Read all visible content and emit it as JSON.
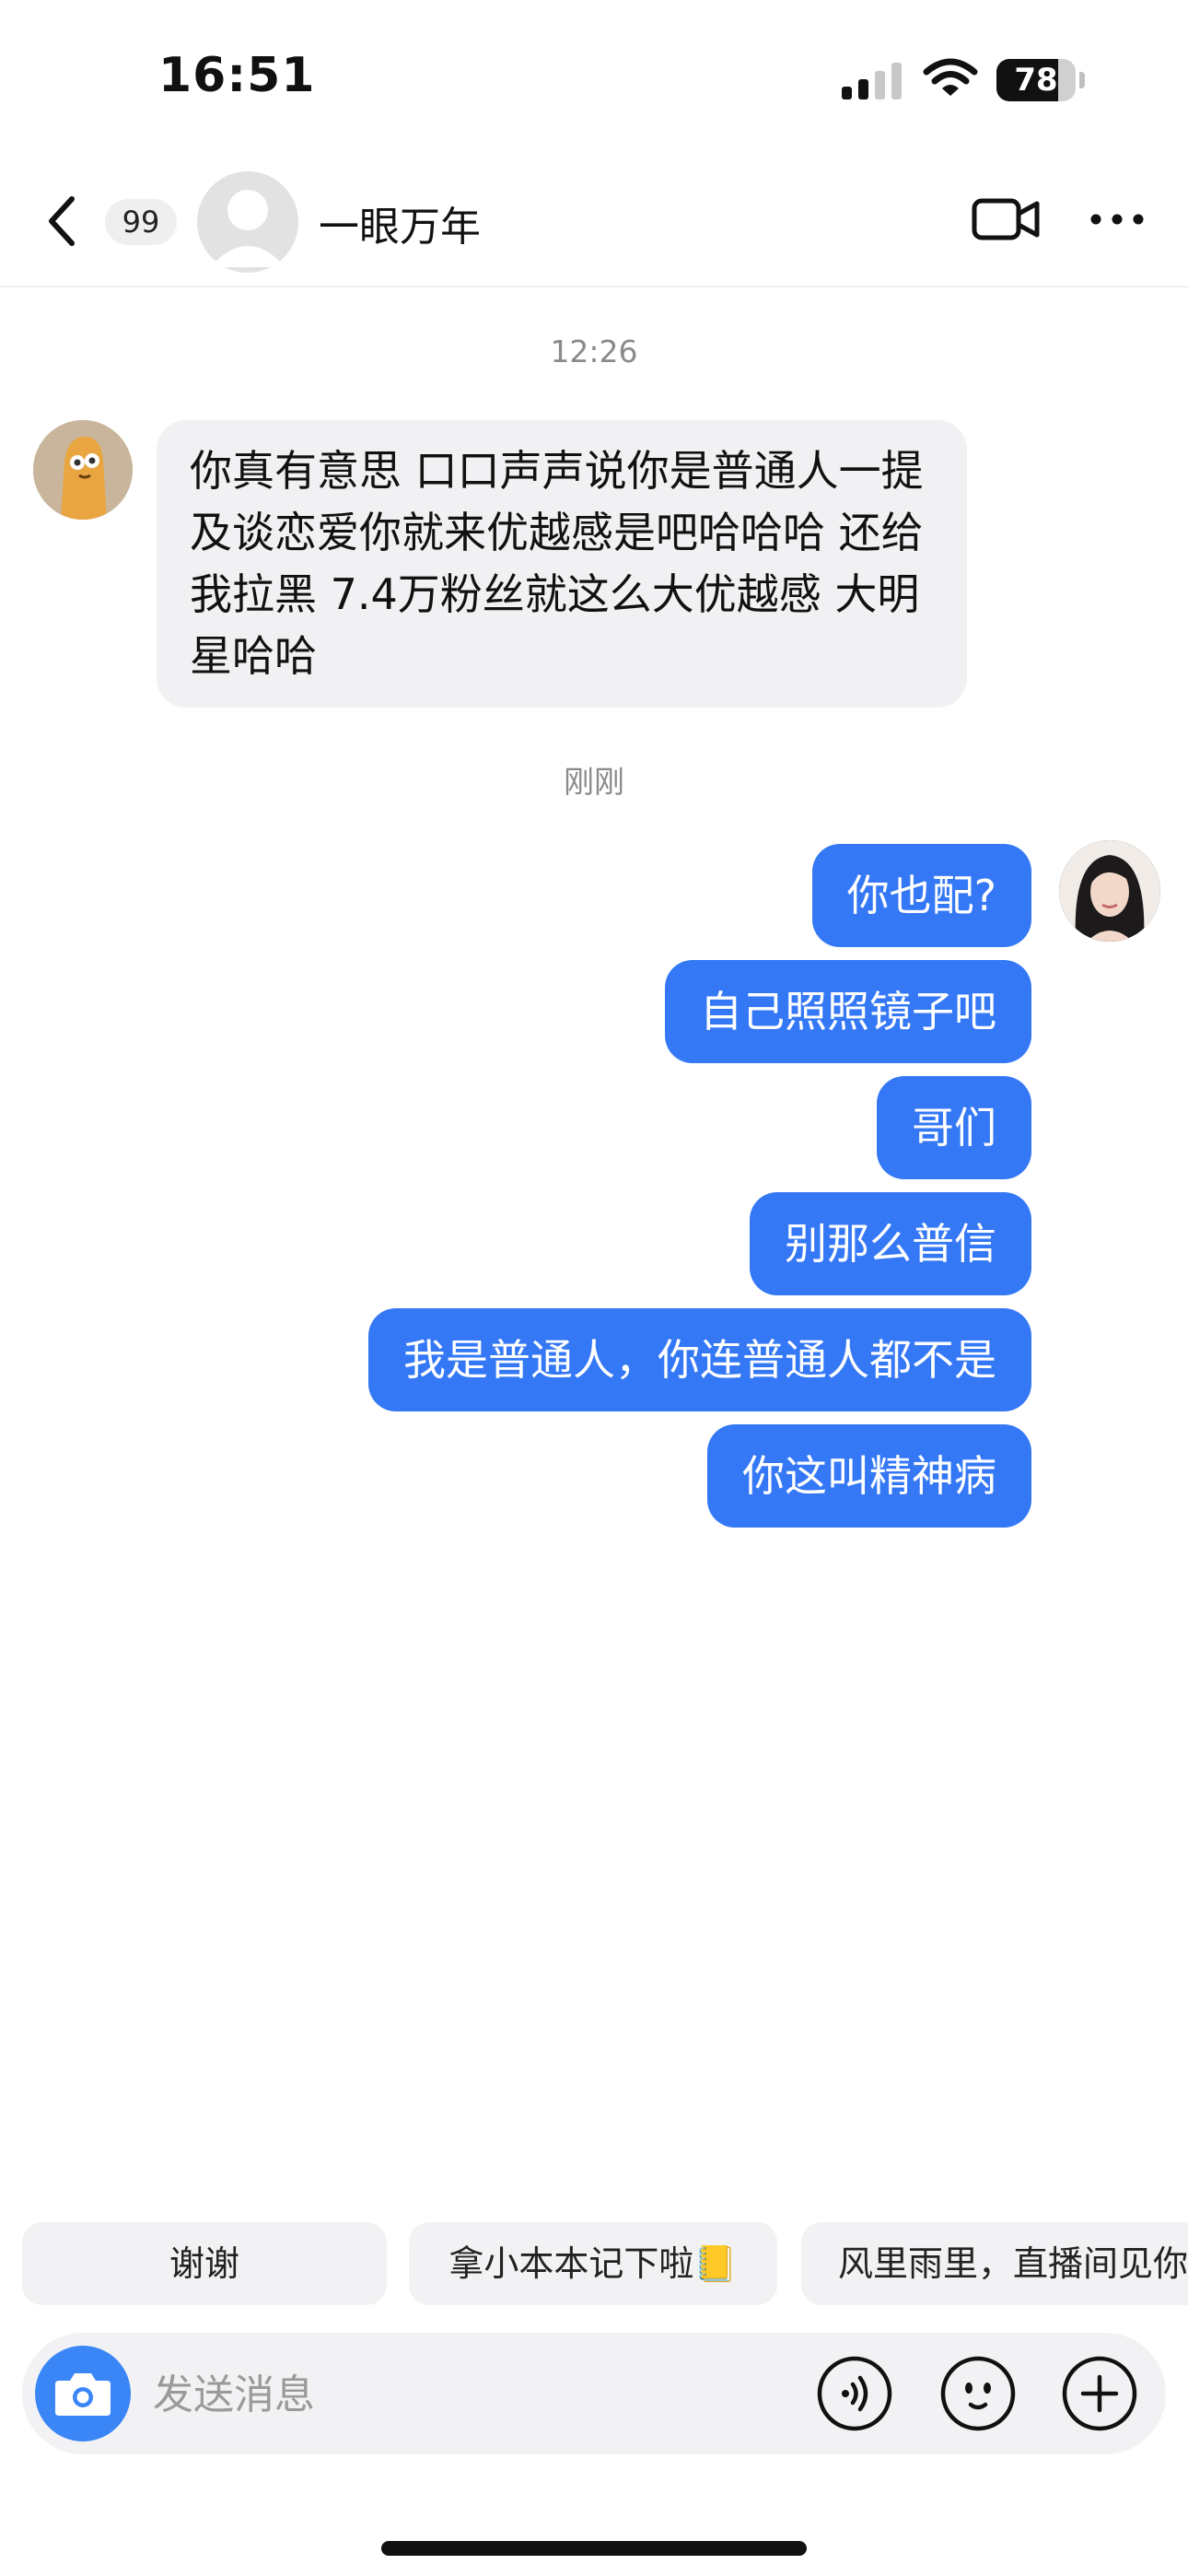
{
  "status_bar": {
    "time": "16:51",
    "battery_percent": "78",
    "battery_level": 0.78
  },
  "header": {
    "unread_count": "99",
    "contact_name": "一眼万年",
    "icons": [
      "back-arrow-icon",
      "video-call-icon",
      "more-icon"
    ]
  },
  "chat": {
    "timestamps": [
      "12:26",
      "刚刚"
    ],
    "received_message": "你真有意思 口口声声说你是普通人一提及谈恋爱你就来优越感是吧哈哈哈 还给我拉黑 7.4万粉丝就这么大优越感 大明星哈哈",
    "sent_messages": [
      "你也配?",
      "自己照照镜子吧",
      "哥们",
      "别那么普信",
      "我是普通人，你连普通人都不是",
      "你这叫精神病"
    ]
  },
  "quick_replies": [
    "谢谢",
    "拿小本本记下啦📒",
    "风里雨里，直播间见你"
  ],
  "input_bar": {
    "placeholder": "发送消息",
    "icons": [
      "camera-icon",
      "voice-icon",
      "emoji-icon",
      "plus-icon"
    ]
  },
  "colors": {
    "sent_bubble": "#3478f6",
    "received_bubble": "#f1f1f3",
    "camera_button": "#3a86f7"
  }
}
